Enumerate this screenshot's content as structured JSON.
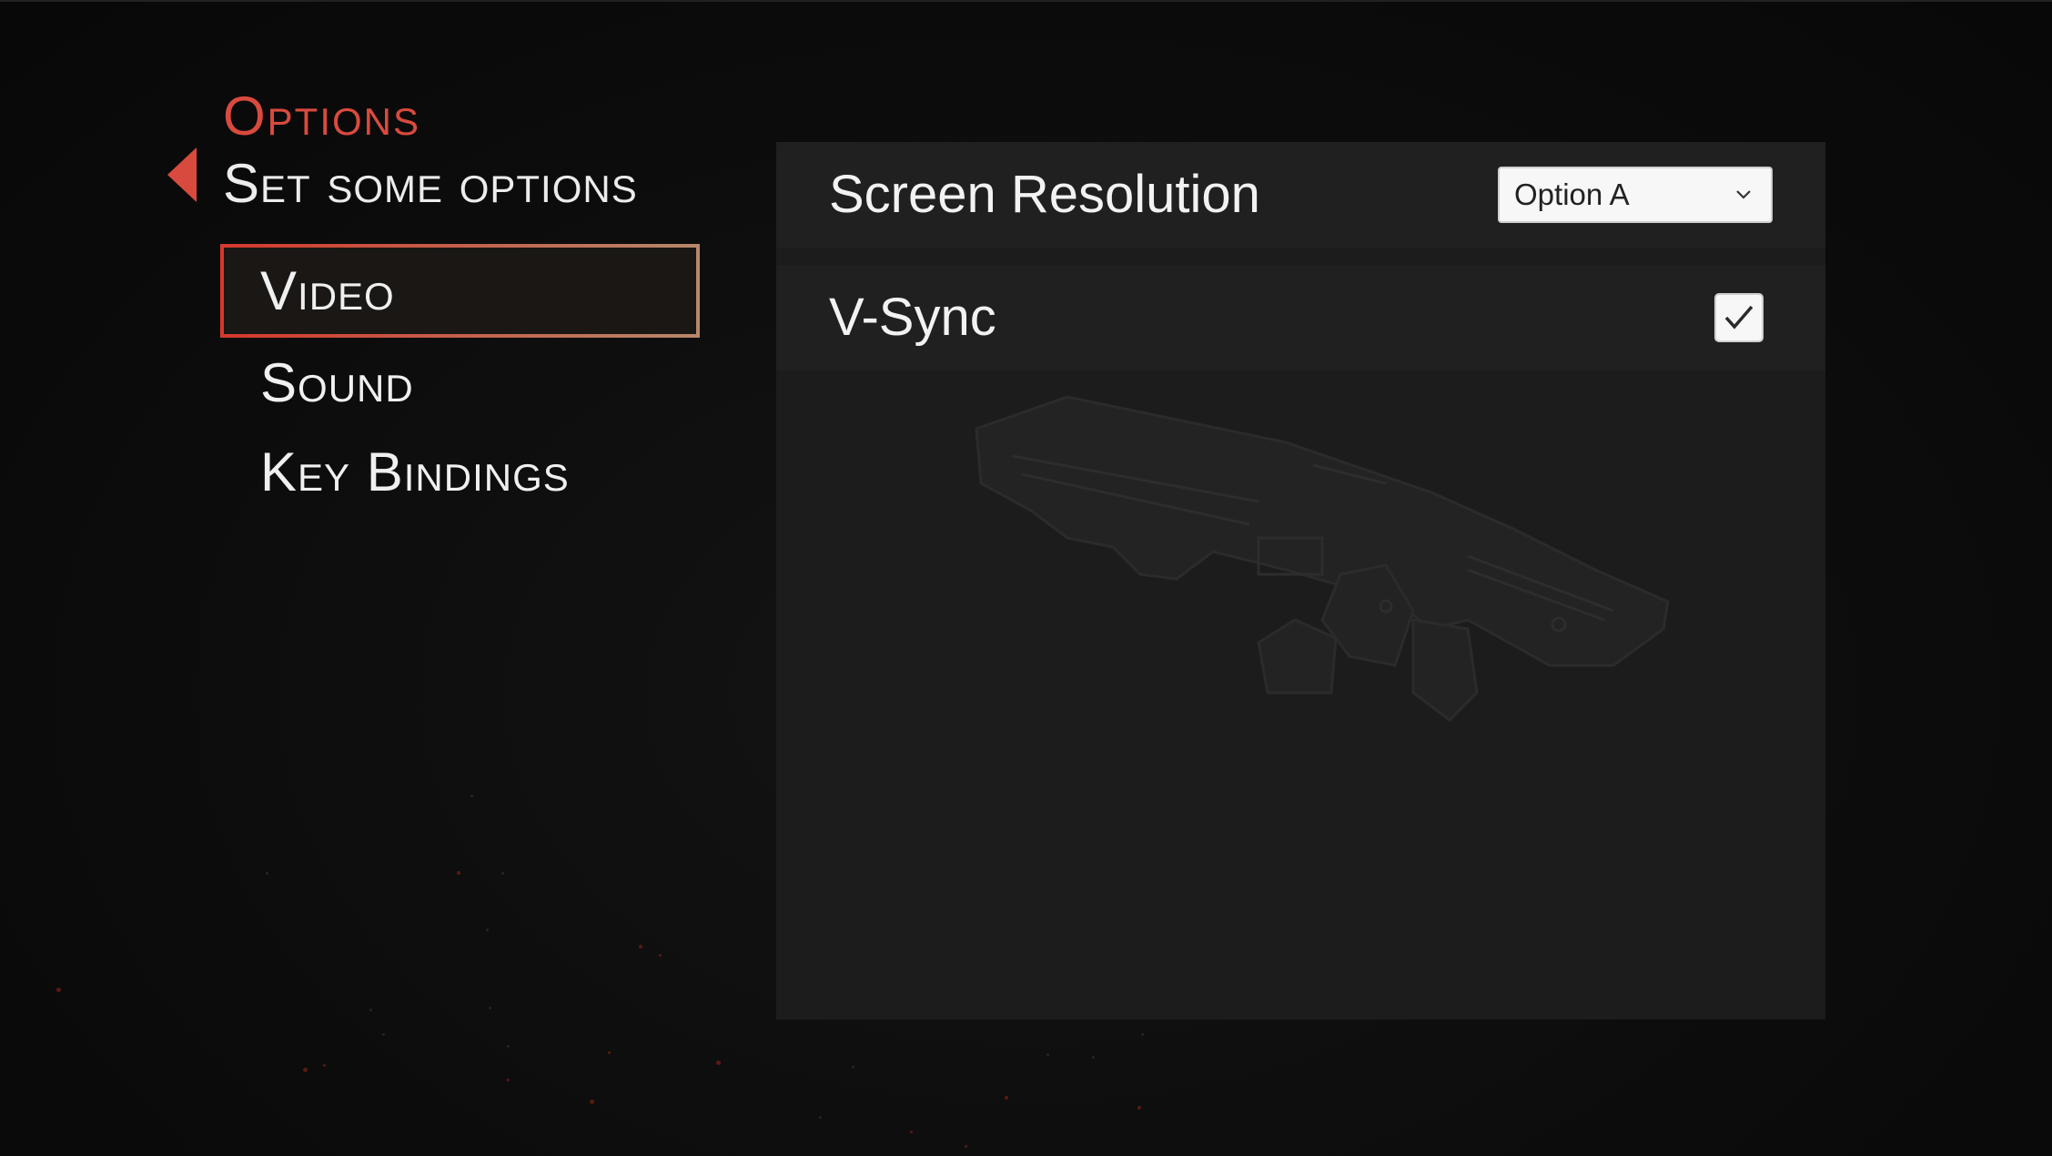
{
  "header": {
    "title": "Options",
    "subtitle": "Set some options",
    "back_icon": "back-arrow-icon"
  },
  "menu": {
    "items": [
      {
        "label": "Video",
        "active": true
      },
      {
        "label": "Sound",
        "active": false
      },
      {
        "label": "Key Bindings",
        "active": false
      }
    ]
  },
  "settings": {
    "resolution": {
      "label": "Screen Resolution",
      "selected": "Option A"
    },
    "vsync": {
      "label": "V-Sync",
      "checked": true
    }
  },
  "colors": {
    "accent": "#d94a3e",
    "panel": "#1c1c1c",
    "row": "#202020",
    "background": "#0c0c0c"
  }
}
